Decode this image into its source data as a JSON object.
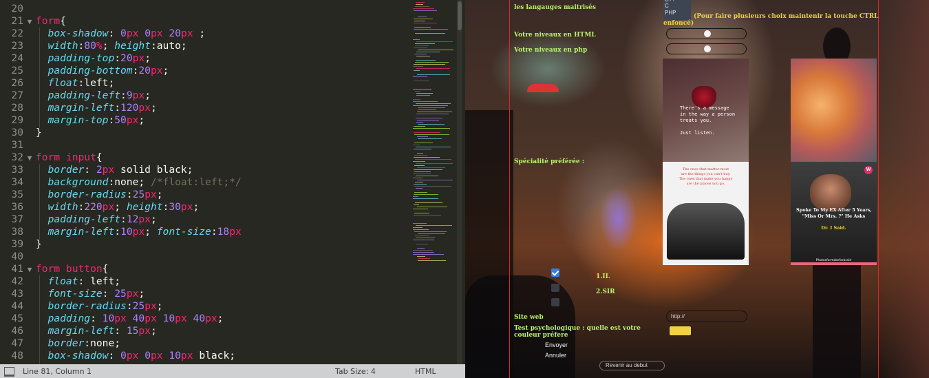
{
  "editor": {
    "lines": [
      {
        "n": "20",
        "tokens": []
      },
      {
        "n": "21",
        "fold": true,
        "tokens": [
          [
            "sel",
            "form"
          ],
          [
            "pun",
            "{"
          ]
        ]
      },
      {
        "n": "22",
        "tokens": [
          [
            "prop",
            "box-shadow"
          ],
          [
            "pun",
            ": "
          ],
          [
            "num",
            "0"
          ],
          [
            "unit",
            "px"
          ],
          [
            "pun",
            " "
          ],
          [
            "num",
            "0"
          ],
          [
            "unit",
            "px"
          ],
          [
            "pun",
            " "
          ],
          [
            "num",
            "20"
          ],
          [
            "unit",
            "px"
          ],
          [
            "pun",
            " ;"
          ]
        ]
      },
      {
        "n": "23",
        "tokens": [
          [
            "prop",
            "width"
          ],
          [
            "pun",
            ":"
          ],
          [
            "num",
            "80"
          ],
          [
            "unit",
            "%"
          ],
          [
            "pun",
            "; "
          ],
          [
            "prop",
            "height"
          ],
          [
            "pun",
            ":auto;"
          ]
        ]
      },
      {
        "n": "24",
        "tokens": [
          [
            "prop",
            "padding-top"
          ],
          [
            "pun",
            ":"
          ],
          [
            "num",
            "20"
          ],
          [
            "unit",
            "px"
          ],
          [
            "pun",
            ";"
          ]
        ]
      },
      {
        "n": "25",
        "tokens": [
          [
            "prop",
            "padding-bottom"
          ],
          [
            "pun",
            ":"
          ],
          [
            "num",
            "20"
          ],
          [
            "unit",
            "px"
          ],
          [
            "pun",
            ";"
          ]
        ]
      },
      {
        "n": "26",
        "tokens": [
          [
            "prop",
            "float"
          ],
          [
            "pun",
            ":left;"
          ]
        ]
      },
      {
        "n": "27",
        "tokens": [
          [
            "prop",
            "padding-left"
          ],
          [
            "pun",
            ":"
          ],
          [
            "num",
            "9"
          ],
          [
            "unit",
            "px"
          ],
          [
            "pun",
            ";"
          ]
        ]
      },
      {
        "n": "28",
        "tokens": [
          [
            "prop",
            "margin-left"
          ],
          [
            "pun",
            ":"
          ],
          [
            "num",
            "120"
          ],
          [
            "unit",
            "px"
          ],
          [
            "pun",
            ";"
          ]
        ]
      },
      {
        "n": "29",
        "tokens": [
          [
            "prop",
            "margin-top"
          ],
          [
            "pun",
            ":"
          ],
          [
            "num",
            "50"
          ],
          [
            "unit",
            "px"
          ],
          [
            "pun",
            ";"
          ]
        ]
      },
      {
        "n": "30",
        "tokens": [
          [
            "pun",
            "}"
          ]
        ]
      },
      {
        "n": "31",
        "tokens": []
      },
      {
        "n": "32",
        "fold": true,
        "tokens": [
          [
            "sel",
            "form input"
          ],
          [
            "pun",
            "{"
          ]
        ]
      },
      {
        "n": "33",
        "tokens": [
          [
            "prop",
            "border"
          ],
          [
            "pun",
            ": "
          ],
          [
            "num",
            "2"
          ],
          [
            "unit",
            "px"
          ],
          [
            "pun",
            " solid black;"
          ]
        ]
      },
      {
        "n": "34",
        "tokens": [
          [
            "prop",
            "background"
          ],
          [
            "pun",
            ":none; "
          ],
          [
            "com",
            "/*float:left;*/"
          ]
        ]
      },
      {
        "n": "35",
        "tokens": [
          [
            "prop",
            "border-radius"
          ],
          [
            "pun",
            ":"
          ],
          [
            "num",
            "25"
          ],
          [
            "unit",
            "px"
          ],
          [
            "pun",
            ";"
          ]
        ]
      },
      {
        "n": "36",
        "tokens": [
          [
            "prop",
            "width"
          ],
          [
            "pun",
            ":"
          ],
          [
            "num",
            "220"
          ],
          [
            "unit",
            "px"
          ],
          [
            "pun",
            "; "
          ],
          [
            "prop",
            "height"
          ],
          [
            "pun",
            ":"
          ],
          [
            "num",
            "30"
          ],
          [
            "unit",
            "px"
          ],
          [
            "pun",
            ";"
          ]
        ]
      },
      {
        "n": "37",
        "tokens": [
          [
            "prop",
            "padding-left"
          ],
          [
            "pun",
            ":"
          ],
          [
            "num",
            "12"
          ],
          [
            "unit",
            "px"
          ],
          [
            "pun",
            ";"
          ]
        ]
      },
      {
        "n": "38",
        "tokens": [
          [
            "prop",
            "margin-left"
          ],
          [
            "pun",
            ":"
          ],
          [
            "num",
            "10"
          ],
          [
            "unit",
            "px"
          ],
          [
            "pun",
            "; "
          ],
          [
            "prop",
            "font-size"
          ],
          [
            "pun",
            ":"
          ],
          [
            "num",
            "18"
          ],
          [
            "unit",
            "px"
          ]
        ]
      },
      {
        "n": "39",
        "tokens": [
          [
            "pun",
            "}"
          ]
        ]
      },
      {
        "n": "40",
        "tokens": []
      },
      {
        "n": "41",
        "fold": true,
        "tokens": [
          [
            "sel",
            "form button"
          ],
          [
            "pun",
            "{"
          ]
        ]
      },
      {
        "n": "42",
        "tokens": [
          [
            "prop",
            "float"
          ],
          [
            "pun",
            ": left;"
          ]
        ]
      },
      {
        "n": "43",
        "tokens": [
          [
            "prop",
            "font-size"
          ],
          [
            "pun",
            ": "
          ],
          [
            "num",
            "25"
          ],
          [
            "unit",
            "px"
          ],
          [
            "pun",
            ";"
          ]
        ]
      },
      {
        "n": "44",
        "tokens": [
          [
            "prop",
            "border-radius"
          ],
          [
            "pun",
            ":"
          ],
          [
            "num",
            "25"
          ],
          [
            "unit",
            "px"
          ],
          [
            "pun",
            ";"
          ]
        ]
      },
      {
        "n": "45",
        "tokens": [
          [
            "prop",
            "padding"
          ],
          [
            "pun",
            ": "
          ],
          [
            "num",
            "10"
          ],
          [
            "unit",
            "px"
          ],
          [
            "pun",
            " "
          ],
          [
            "num",
            "40"
          ],
          [
            "unit",
            "px"
          ],
          [
            "pun",
            " "
          ],
          [
            "num",
            "10"
          ],
          [
            "unit",
            "px"
          ],
          [
            "pun",
            " "
          ],
          [
            "num",
            "40"
          ],
          [
            "unit",
            "px"
          ],
          [
            "pun",
            ";"
          ]
        ]
      },
      {
        "n": "46",
        "tokens": [
          [
            "prop",
            "margin-left"
          ],
          [
            "pun",
            ": "
          ],
          [
            "num",
            "15"
          ],
          [
            "unit",
            "px"
          ],
          [
            "pun",
            ";"
          ]
        ]
      },
      {
        "n": "47",
        "tokens": [
          [
            "prop",
            "border"
          ],
          [
            "pun",
            ":none;"
          ]
        ]
      },
      {
        "n": "48",
        "tokens": [
          [
            "prop",
            "box-shadow"
          ],
          [
            "pun",
            ": "
          ],
          [
            "num",
            "0"
          ],
          [
            "unit",
            "px"
          ],
          [
            "pun",
            " "
          ],
          [
            "num",
            "0"
          ],
          [
            "unit",
            "px"
          ],
          [
            "pun",
            " "
          ],
          [
            "num",
            "10"
          ],
          [
            "unit",
            "px"
          ],
          [
            "pun",
            " black;"
          ]
        ]
      }
    ],
    "colors": {
      "background": "#272822",
      "selector": "#f92672",
      "property": "#66d9ef",
      "number": "#ae81ff",
      "comment": "#75715e"
    }
  },
  "statusbar": {
    "position": "Line 81, Column 1",
    "tab_size": "Tab Size: 4",
    "syntax": "HTML"
  },
  "form": {
    "languages_label": "les langauges maitrisés",
    "languages_options": [
      "C++",
      "C",
      "PHP"
    ],
    "languages_note": "(Pour faire plusieurs choix maintenir la touche CTRL enfoncé)",
    "html_label": "Votre niveaux en HTML",
    "php_label": "Votre niveaux en php",
    "html_level": 0.5,
    "php_level": 0.5,
    "speciality_label": "Spécialité préférée :",
    "images": [
      {
        "name": "message-image",
        "text": "There's a message\nin the way a person\ntreats you.\n\nJust listen."
      },
      {
        "name": "gummy-candy-image"
      },
      {
        "name": "friends-quote-image",
        "caption": "The ones that matter most\nare the things you can't buy.\nThe ones that make you happy\nare the places you go."
      },
      {
        "name": "ex-story-image",
        "badge": "W",
        "question": "Spoke To My EX After 5 Years,\n\"Miss Or Mrs. ?\" He Asks",
        "answer": "Dr. I Said.",
        "footer": "Photosformakeforbraid"
      }
    ],
    "checkboxes": [
      {
        "label": "1.IL",
        "checked": true
      },
      {
        "label": "2.SIR",
        "checked": false
      },
      {
        "label": "",
        "checked": false
      }
    ],
    "site_label": "Site web",
    "site_placeholder": "http://",
    "test_label": "Test psychologique : quelle est votre couleur préfere",
    "color_value": "#f4d046",
    "submit_label": "Envoyer",
    "reset_label": "Annuler",
    "back_label": "Revenir au debut",
    "label_color": "#b9f36b",
    "note_color": "#e8d443",
    "frame_color": "#d9282d"
  }
}
